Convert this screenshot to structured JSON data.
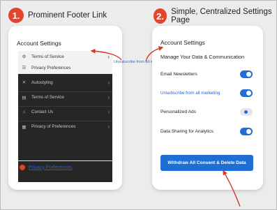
{
  "steps": [
    {
      "number": "1.",
      "title": "Prominent Footer Link"
    },
    {
      "number": "2.",
      "title": "Simple, Centralized Settings Page"
    }
  ],
  "left_card": {
    "heading": "Account Settings",
    "menu_light": [
      {
        "icon": "gear-icon",
        "glyph": "⚙",
        "label": "Terms of Service",
        "chevron": "›"
      },
      {
        "icon": "list-icon",
        "glyph": "☰",
        "label": "Privacy Preferences",
        "chevron": ""
      }
    ],
    "menu_dark": [
      {
        "icon": "tools-icon",
        "glyph": "✕",
        "label": "Autostyling",
        "chevron": "›"
      },
      {
        "icon": "document-icon",
        "glyph": "▤",
        "label": "Terms of Service",
        "chevron": "›"
      },
      {
        "icon": "building-icon",
        "glyph": "⌂",
        "label": "Contact Us",
        "chevron": "›"
      },
      {
        "icon": "grid-icon",
        "glyph": "▦",
        "label": "Privacy of Preferences",
        "chevron": "›"
      }
    ],
    "footer_link": "Privacy Preferences",
    "floating_text": "Unsubscribe from all marketing"
  },
  "right_card": {
    "heading": "Account Settings",
    "subheading": "Manage Your Data & Communication",
    "settings": [
      {
        "label": "Email Newsletters",
        "state": "on",
        "is_link": false
      },
      {
        "label": "Unsubscribe from all marketing",
        "state": "on",
        "is_link": true
      },
      {
        "label": "Personalized Ads",
        "state": "off",
        "is_link": false
      },
      {
        "label": "Data Sharing for Analytics",
        "state": "on",
        "is_link": false
      }
    ],
    "primary_button": "Withdraw All Consent & Delete Data"
  },
  "colors": {
    "accent_red": "#e4442b",
    "toggle_blue": "#1f6ed4",
    "link_blue": "#2a5bd7",
    "dark_menu": "#262626"
  }
}
